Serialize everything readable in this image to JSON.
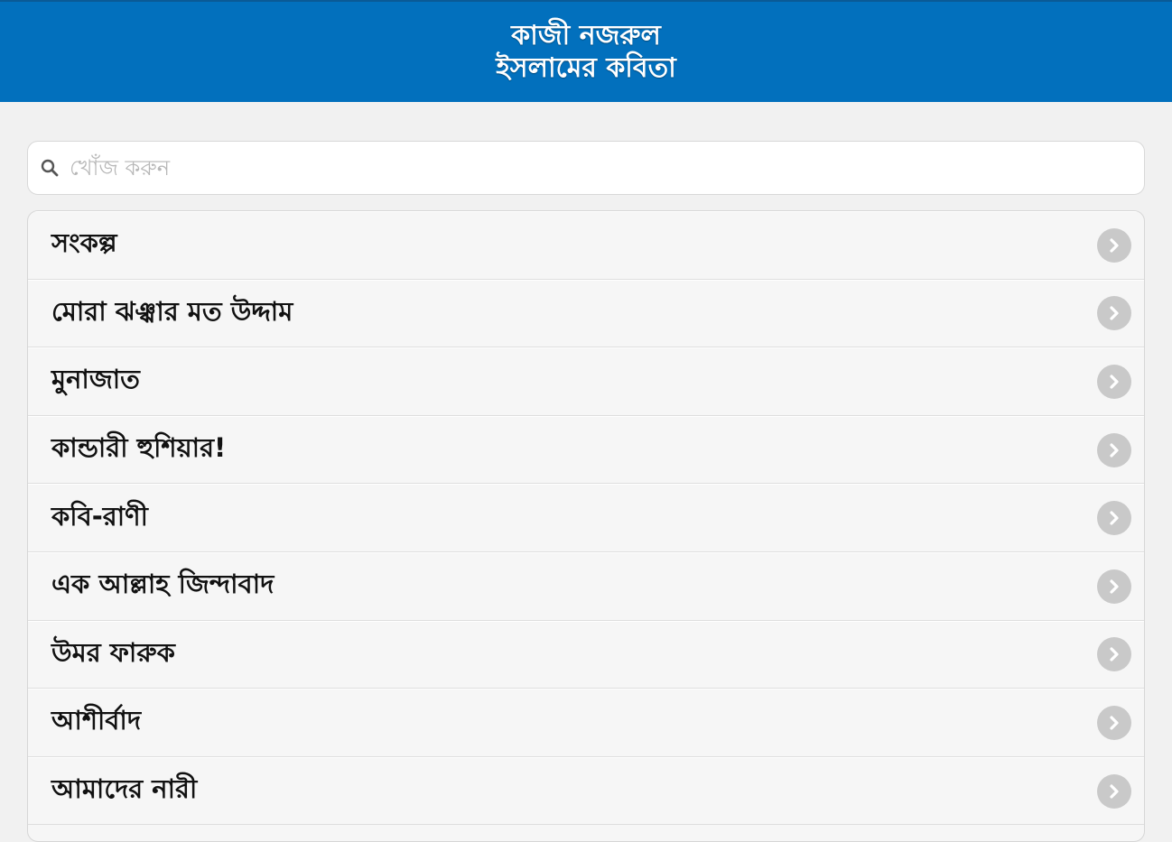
{
  "header": {
    "title_line1": "কাজী নজরুল",
    "title_line2": "ইসলামের কবিতা"
  },
  "search": {
    "placeholder": "খোঁজ করুন",
    "icon": "search-icon"
  },
  "list": {
    "items": [
      {
        "label": "সংকল্প"
      },
      {
        "label": "মোরা ঝঞ্ঝার মত উদ্দাম"
      },
      {
        "label": "মুনাজাত"
      },
      {
        "label": "কান্ডারী হুশিয়ার!"
      },
      {
        "label": "কবি-রাণী"
      },
      {
        "label": "এক আল্লাহ জিন্দাবাদ"
      },
      {
        "label": "উমর ফারুক"
      },
      {
        "label": "আশীর্বাদ"
      },
      {
        "label": "আমাদের নারী"
      }
    ],
    "item_icon": "chevron-right-icon"
  },
  "colors": {
    "header_bg": "#0270bd",
    "page_bg": "#f1f1f1",
    "chevron_bg": "#c9c9c9"
  }
}
